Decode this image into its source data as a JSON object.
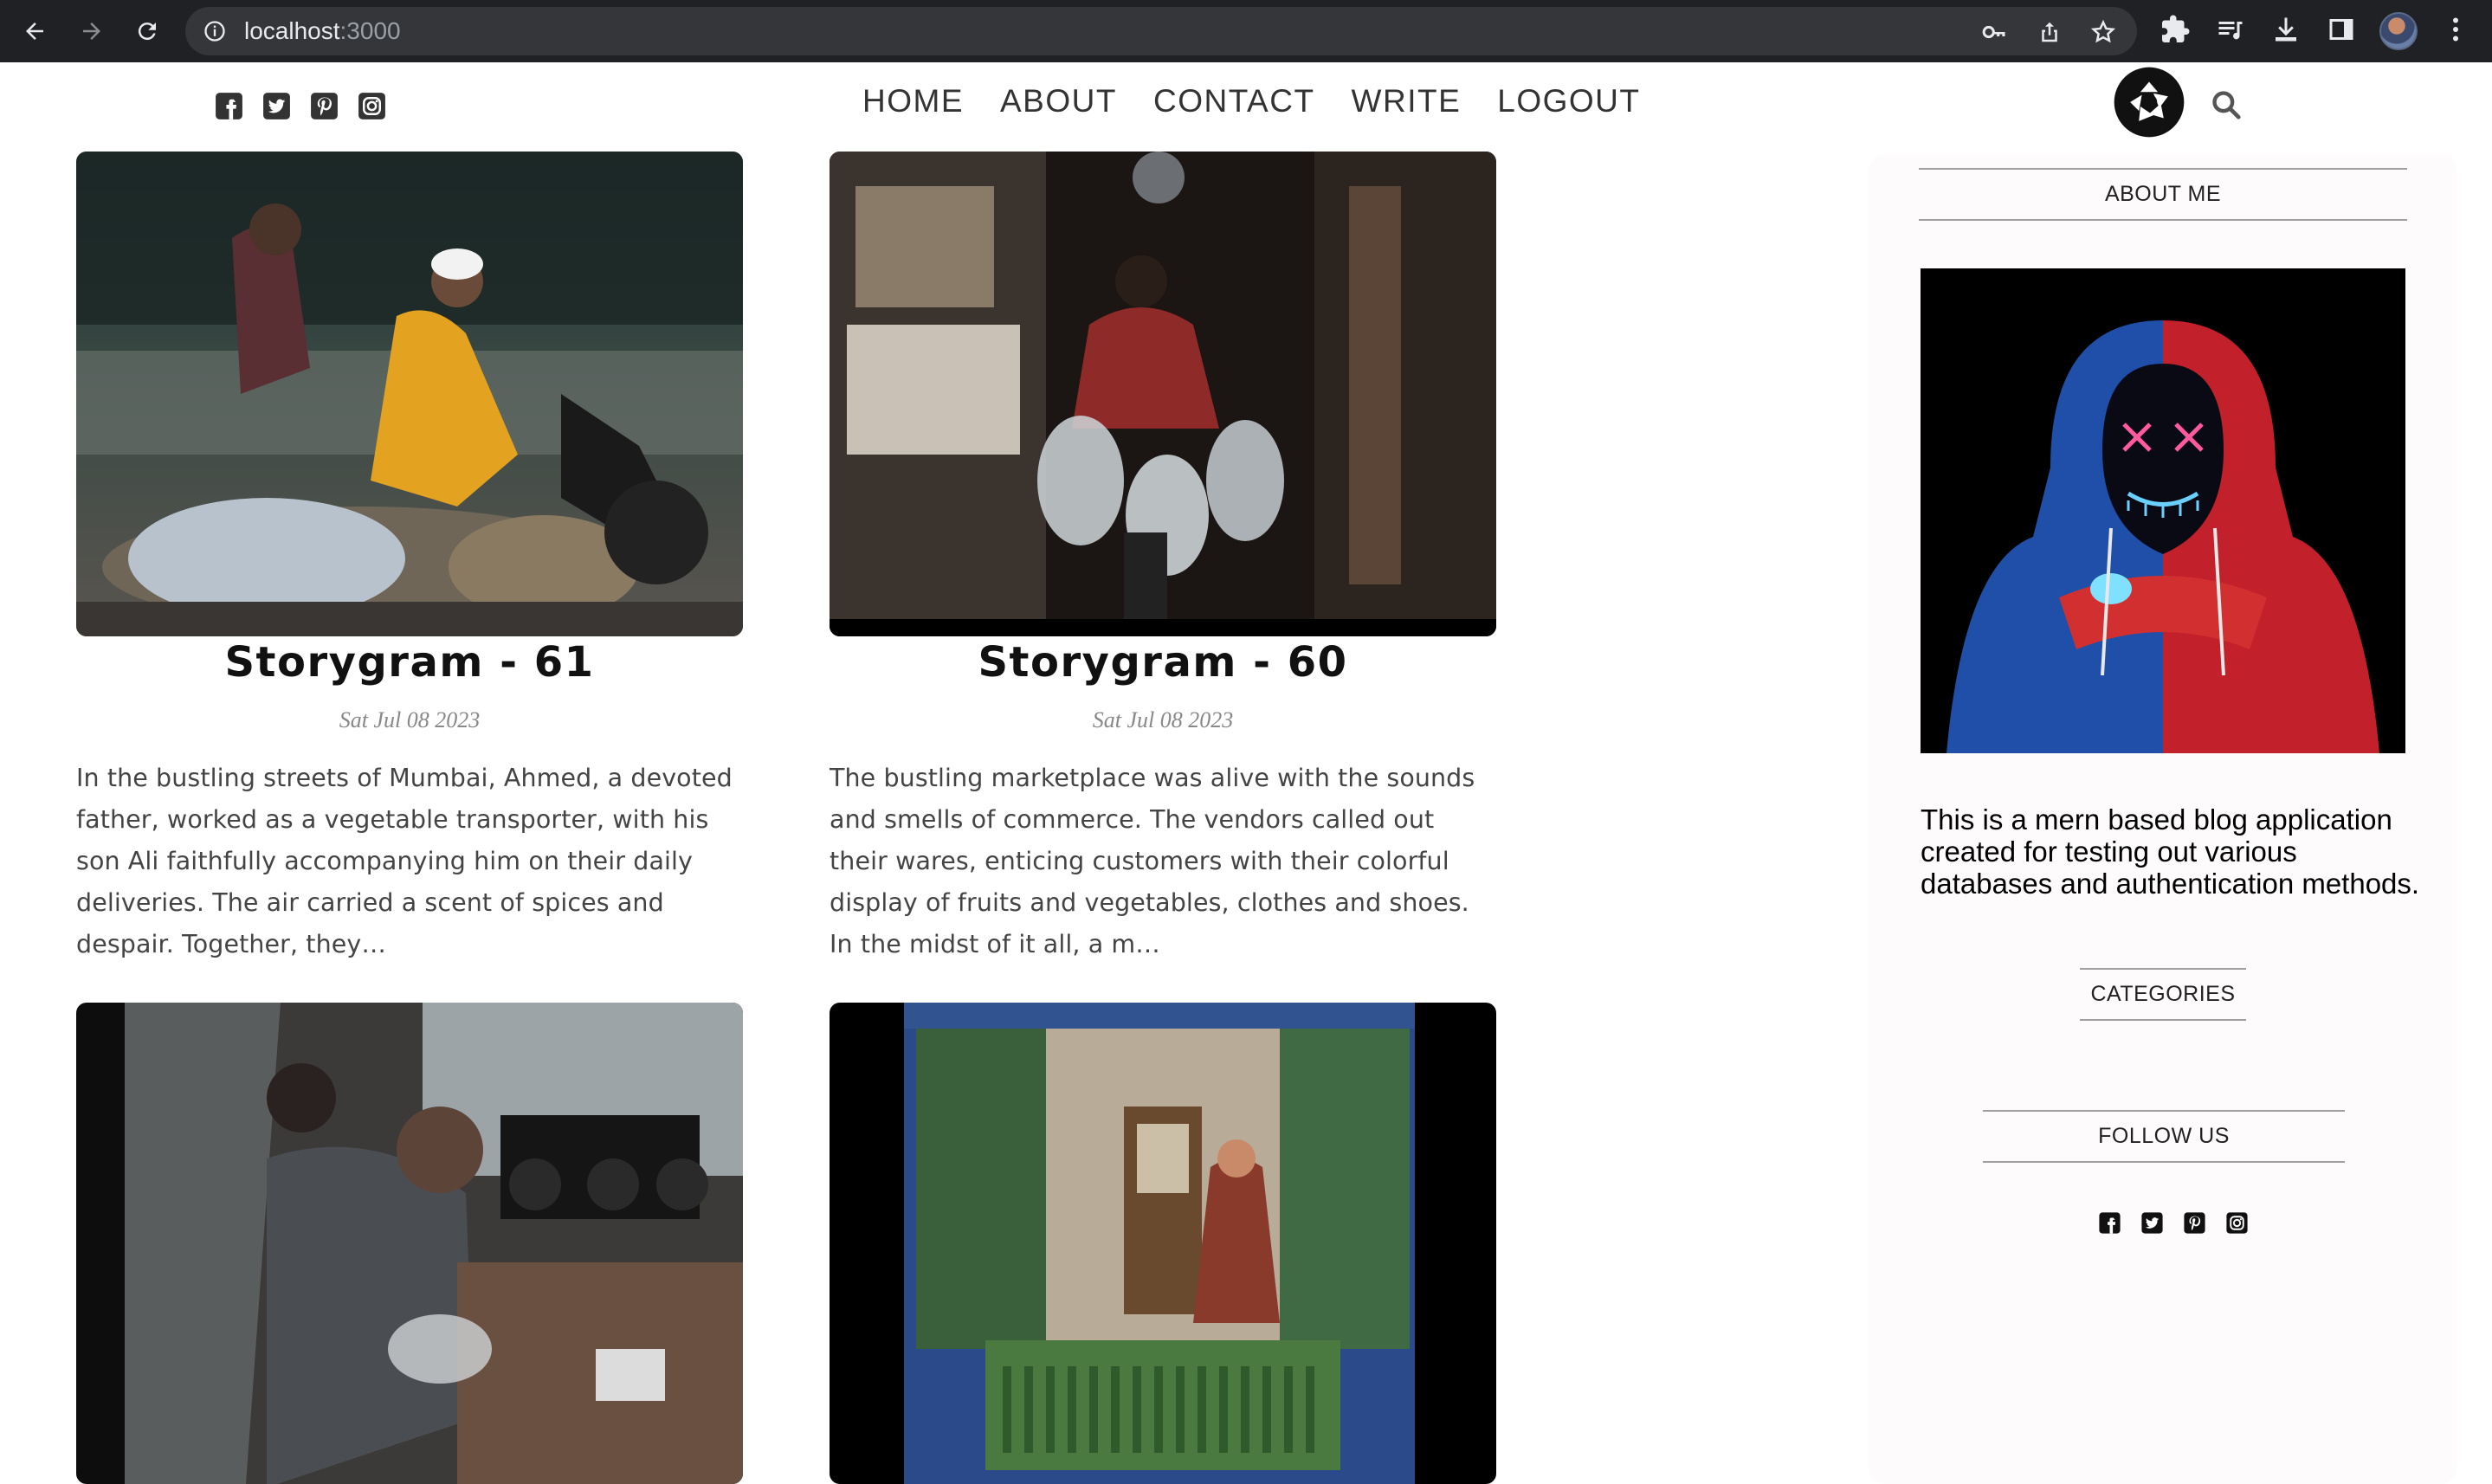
{
  "browser": {
    "url_host": "localhost",
    "url_port": ":3000",
    "icons": [
      "back-icon",
      "forward-icon",
      "reload-icon",
      "info-icon",
      "key-icon",
      "share-icon",
      "star-icon",
      "extensions-icon",
      "media-icon",
      "download-icon",
      "side-panel-icon",
      "profile-avatar",
      "menu-icon"
    ]
  },
  "header": {
    "social_icons": [
      "facebook-icon",
      "twitter-icon",
      "pinterest-icon",
      "instagram-icon"
    ],
    "menu": [
      "HOME",
      "ABOUT",
      "CONTACT",
      "WRITE",
      "LOGOUT"
    ],
    "logo_icon": "camera-aperture-icon",
    "search_icon": "search-icon"
  },
  "posts": [
    {
      "title": "Storygram - 61",
      "date": "Sat Jul 08 2023",
      "desc": "In the bustling streets of Mumbai, Ahmed, a devoted father, worked as a vegetable transporter, with his son Ali faithfully accompanying him on their daily deliveries. The air carried a scent of spices and despair. Together, they…",
      "image": "man and boy on motorbike carrying sacks"
    },
    {
      "title": "Storygram - 60",
      "date": "Sat Jul 08 2023",
      "desc": "The bustling marketplace was alive with the sounds and smells of commerce. The vendors called out their wares, enticing customers with their colorful display of fruits and vegetables, clothes and shoes. In the midst of it all, a m…",
      "image": "man carrying water jugs in market"
    },
    {
      "title": "",
      "date": "",
      "desc": "",
      "image": "man repairing cameras at workbench"
    },
    {
      "title": "",
      "date": "",
      "desc": "",
      "image": "woman sitting in green window frame"
    }
  ],
  "sidebar": {
    "about_title": "ABOUT ME",
    "about_image": "hooded figure with neon mask",
    "about_text": "This is a mern based blog application created for testing out various databases and authentication methods.",
    "categories_title": "CATEGORIES",
    "follow_title": "FOLLOW US",
    "social_icons": [
      "facebook-icon",
      "twitter-icon",
      "pinterest-icon",
      "instagram-icon"
    ]
  }
}
